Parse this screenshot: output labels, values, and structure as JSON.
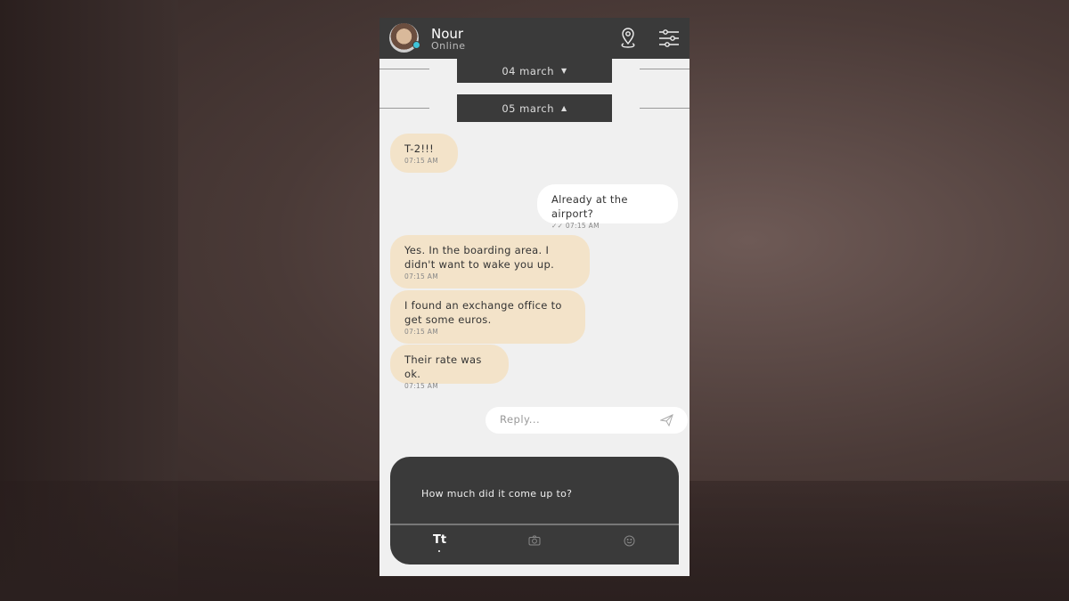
{
  "contact": {
    "name": "Nour",
    "status": "Online",
    "status_color": "#3fc3d8"
  },
  "header_icons": [
    "location-pin-icon",
    "filter-sliders-icon"
  ],
  "date_separators": [
    {
      "label": "04 march",
      "state": "collapsed"
    },
    {
      "label": "05 march",
      "state": "expanded"
    }
  ],
  "messages": [
    {
      "direction": "incoming",
      "text": "T-2!!!",
      "time": "07:15 AM"
    },
    {
      "direction": "outgoing",
      "text": "Already at the airport?",
      "time": "07:15 AM",
      "read": true
    },
    {
      "direction": "incoming",
      "text": "Yes. In the boarding area. I didn't want to wake you up.",
      "time": "07:15 AM"
    },
    {
      "direction": "incoming",
      "text": "I found an exchange office to get some euros.",
      "time": "07:15 AM"
    },
    {
      "direction": "incoming",
      "text": "Their rate was ok.",
      "time": "07:15 AM"
    }
  ],
  "reply": {
    "placeholder": "Reply..."
  },
  "compose": {
    "suggestion": "How much did it come up to?",
    "tools": {
      "text": "Tt",
      "camera": "camera-icon",
      "emoji": "emoji-icon"
    }
  },
  "colors": {
    "incoming_bubble": "#f3e3c9",
    "outgoing_bubble": "#ffffff",
    "dark_panel": "#3a3a3a"
  }
}
